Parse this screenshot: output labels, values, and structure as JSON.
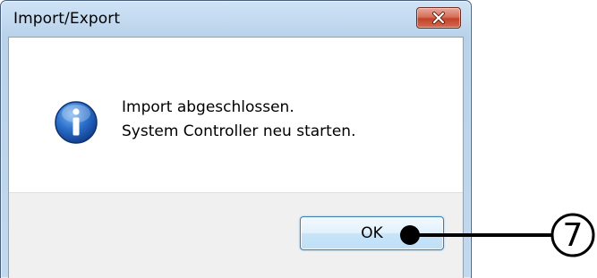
{
  "window": {
    "title": "Import/Export"
  },
  "icons": {
    "close": "close-icon",
    "info": "info-icon"
  },
  "message": {
    "line1": "Import abgeschlossen.",
    "line2": "System Controller neu starten."
  },
  "buttons": {
    "ok_label": "OK"
  },
  "annotation": {
    "number": "7"
  },
  "colors": {
    "close_button": "#c7472f",
    "info_icon": "#1f5fb8",
    "button_area": "#f0f0f0"
  }
}
